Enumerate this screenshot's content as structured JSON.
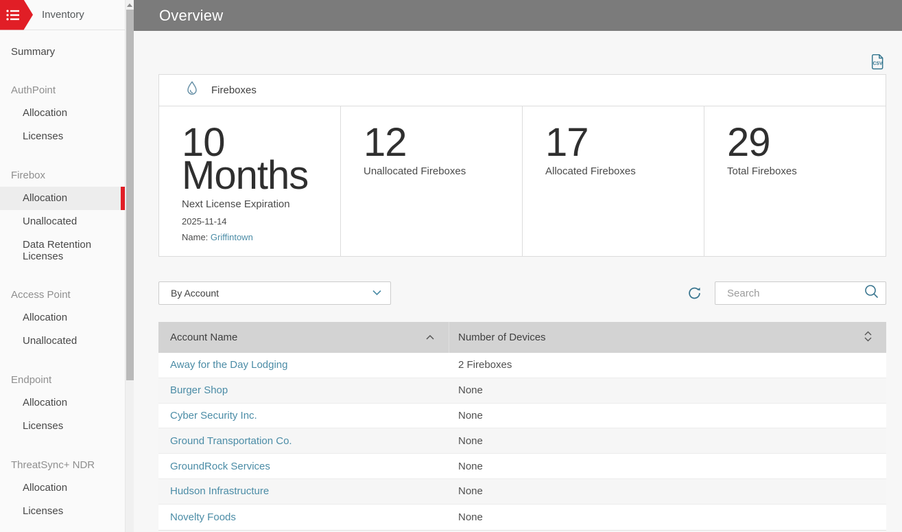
{
  "colors": {
    "accent_red": "#e11e26",
    "topbar_gray": "#7b7b7b",
    "link_teal": "#4b8ca6",
    "icon_teal": "#33758e",
    "table_header_gray": "#d3d3d3",
    "content_background": "#f7f7f7",
    "selected_item_background": "#ededed"
  },
  "icons": {
    "menu": "list-icon",
    "export": "csv-file-icon",
    "card": "firebox-flame-icon",
    "dropdown": "chevron-down-icon",
    "refresh": "refresh-icon",
    "search": "search-icon",
    "sort_ascending": "chevron-up-icon",
    "sort_both": "sort-updown-icon",
    "scroll_up": "arrow-up-icon"
  },
  "sidebar": {
    "title": "Inventory",
    "items": [
      {
        "label": "Summary",
        "type": "item",
        "indent": false,
        "selected": false
      },
      {
        "label": "AuthPoint",
        "type": "section"
      },
      {
        "label": "Allocation",
        "type": "item",
        "indent": true,
        "selected": false
      },
      {
        "label": "Licenses",
        "type": "item",
        "indent": true,
        "selected": false
      },
      {
        "label": "Firebox",
        "type": "section"
      },
      {
        "label": "Allocation",
        "type": "item",
        "indent": true,
        "selected": true
      },
      {
        "label": "Unallocated",
        "type": "item",
        "indent": true,
        "selected": false
      },
      {
        "label": "Data Retention Licenses",
        "type": "item",
        "indent": true,
        "selected": false
      },
      {
        "label": "Access Point",
        "type": "section"
      },
      {
        "label": "Allocation",
        "type": "item",
        "indent": true,
        "selected": false
      },
      {
        "label": "Unallocated",
        "type": "item",
        "indent": true,
        "selected": false
      },
      {
        "label": "Endpoint",
        "type": "section"
      },
      {
        "label": "Allocation",
        "type": "item",
        "indent": true,
        "selected": false
      },
      {
        "label": "Licenses",
        "type": "item",
        "indent": true,
        "selected": false
      },
      {
        "label": "ThreatSync+ NDR",
        "type": "section"
      },
      {
        "label": "Allocation",
        "type": "item",
        "indent": true,
        "selected": false
      },
      {
        "label": "Licenses",
        "type": "item",
        "indent": true,
        "selected": false
      }
    ]
  },
  "header": {
    "title": "Overview"
  },
  "export": {
    "csv_label": "CSV"
  },
  "card": {
    "title": "Fireboxes",
    "stats": [
      {
        "value": "10",
        "unit": "Months",
        "label": "Next License Expiration",
        "date": "2025-11-14",
        "name_label": "Name:",
        "name_link": "Griffintown"
      },
      {
        "value": "12",
        "label": "Unallocated Fireboxes"
      },
      {
        "value": "17",
        "label": "Allocated Fireboxes"
      },
      {
        "value": "29",
        "label": "Total Fireboxes"
      }
    ]
  },
  "controls": {
    "filter_value": "By Account",
    "search_placeholder": "Search"
  },
  "table": {
    "columns": [
      {
        "label": "Account Name",
        "sort": "asc"
      },
      {
        "label": "Number of Devices",
        "sort": "none"
      }
    ],
    "rows": [
      {
        "account": "Away for the Day Lodging",
        "devices": "2 Fireboxes"
      },
      {
        "account": "Burger Shop",
        "devices": "None"
      },
      {
        "account": "Cyber Security Inc.",
        "devices": "None"
      },
      {
        "account": "Ground Transportation Co.",
        "devices": "None"
      },
      {
        "account": "GroundRock Services",
        "devices": "None"
      },
      {
        "account": "Hudson Infrastructure",
        "devices": "None"
      },
      {
        "account": "Novelty Foods",
        "devices": "None"
      }
    ]
  }
}
